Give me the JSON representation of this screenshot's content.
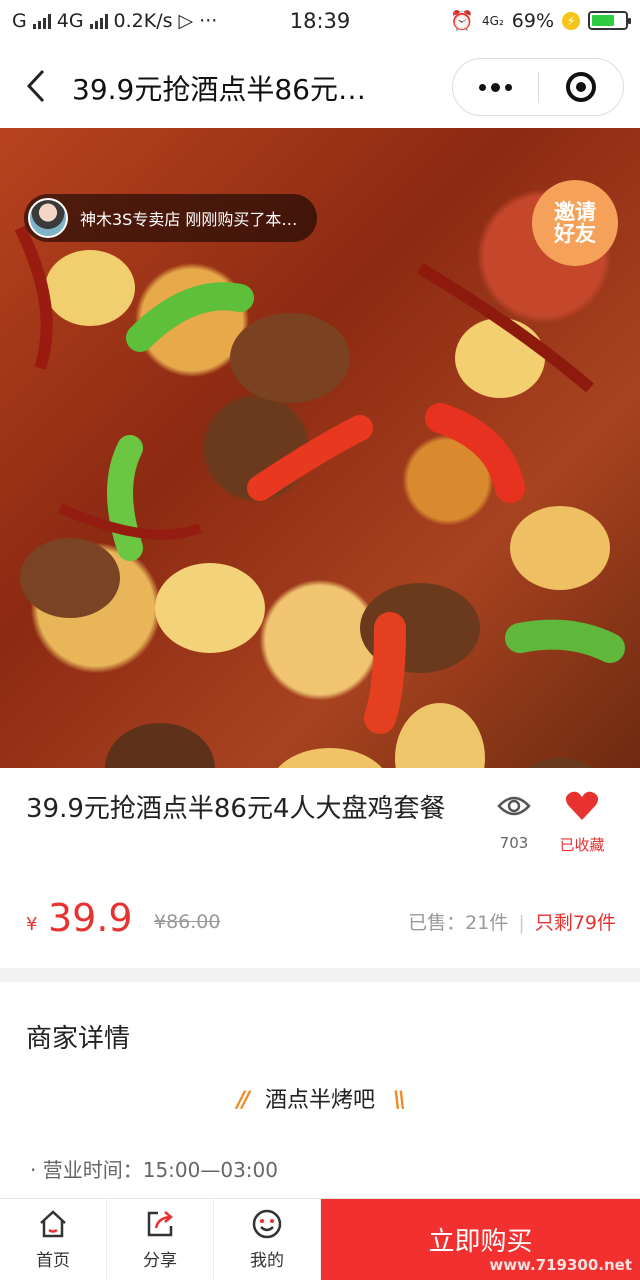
{
  "status_bar": {
    "carrier1": "G",
    "carrier2": "4G",
    "net_speed": "0.2K/s",
    "time": "18:39",
    "net_type": "4G₂",
    "battery_percent": "69%",
    "battery_level": 0.69
  },
  "nav": {
    "title": "39.9元抢酒点半86元…"
  },
  "hero": {
    "ticker_text": "神木3S专卖店 刚刚购买了本…",
    "invite_line1": "邀请",
    "invite_line2": "好友"
  },
  "product": {
    "title": "39.9元抢酒点半86元4人大盘鸡套餐",
    "views": "703",
    "favorite_label": "已收藏",
    "currency": "¥",
    "price": "39.9",
    "original_price": "¥86.00",
    "sold_text": "已售：21件",
    "separator": "|",
    "remaining_text": "只剩79件"
  },
  "merchant": {
    "section_title": "商家详情",
    "shop_name": "酒点半烤吧",
    "deco_left": "//",
    "deco_right": "\\\\",
    "hours": "· 营业时间：15:00—03:00"
  },
  "tabbar": {
    "home": "首页",
    "share": "分享",
    "mine": "我的",
    "buy": "立即购买",
    "watermark": "www.719300.net"
  },
  "colors": {
    "accent": "#e8322f",
    "buy_bg": "#f23030",
    "invite_bg": "#f6a15a"
  }
}
